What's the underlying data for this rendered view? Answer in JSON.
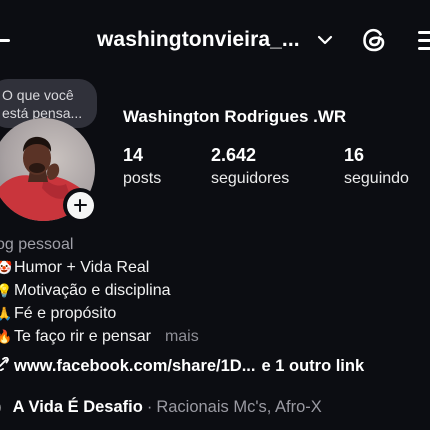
{
  "header": {
    "username": "washingtonvieira_...",
    "icons": [
      "back-arrow-icon",
      "chevron-down-icon",
      "threads-icon",
      "menu-icon"
    ]
  },
  "note": {
    "line1": "O que você",
    "line2": "está pensa..."
  },
  "profile": {
    "full_name": "Washington Rodrigues .WR",
    "stats": {
      "posts": {
        "value": "14",
        "label": "posts"
      },
      "followers": {
        "value": "2.642",
        "label": "seguidores"
      },
      "following": {
        "value": "16",
        "label": "seguindo"
      }
    }
  },
  "bio": {
    "category": "og pessoal",
    "lines": [
      {
        "emoji": "🤡",
        "text": "Humor + Vida Real"
      },
      {
        "emoji": "💡",
        "text": "Motivação e disciplina"
      },
      {
        "emoji": "🙏",
        "text": "Fé e propósito"
      },
      {
        "emoji": "🔥",
        "text": "Te faço rir e pensar"
      }
    ],
    "more_label": "mais"
  },
  "link": {
    "url": "www.facebook.com/share/1D...",
    "extra": "e 1 outro link"
  },
  "music": {
    "song": "A Vida É Desafio",
    "separator": "·",
    "artists": "Racionais Mc's, Afro-X"
  }
}
